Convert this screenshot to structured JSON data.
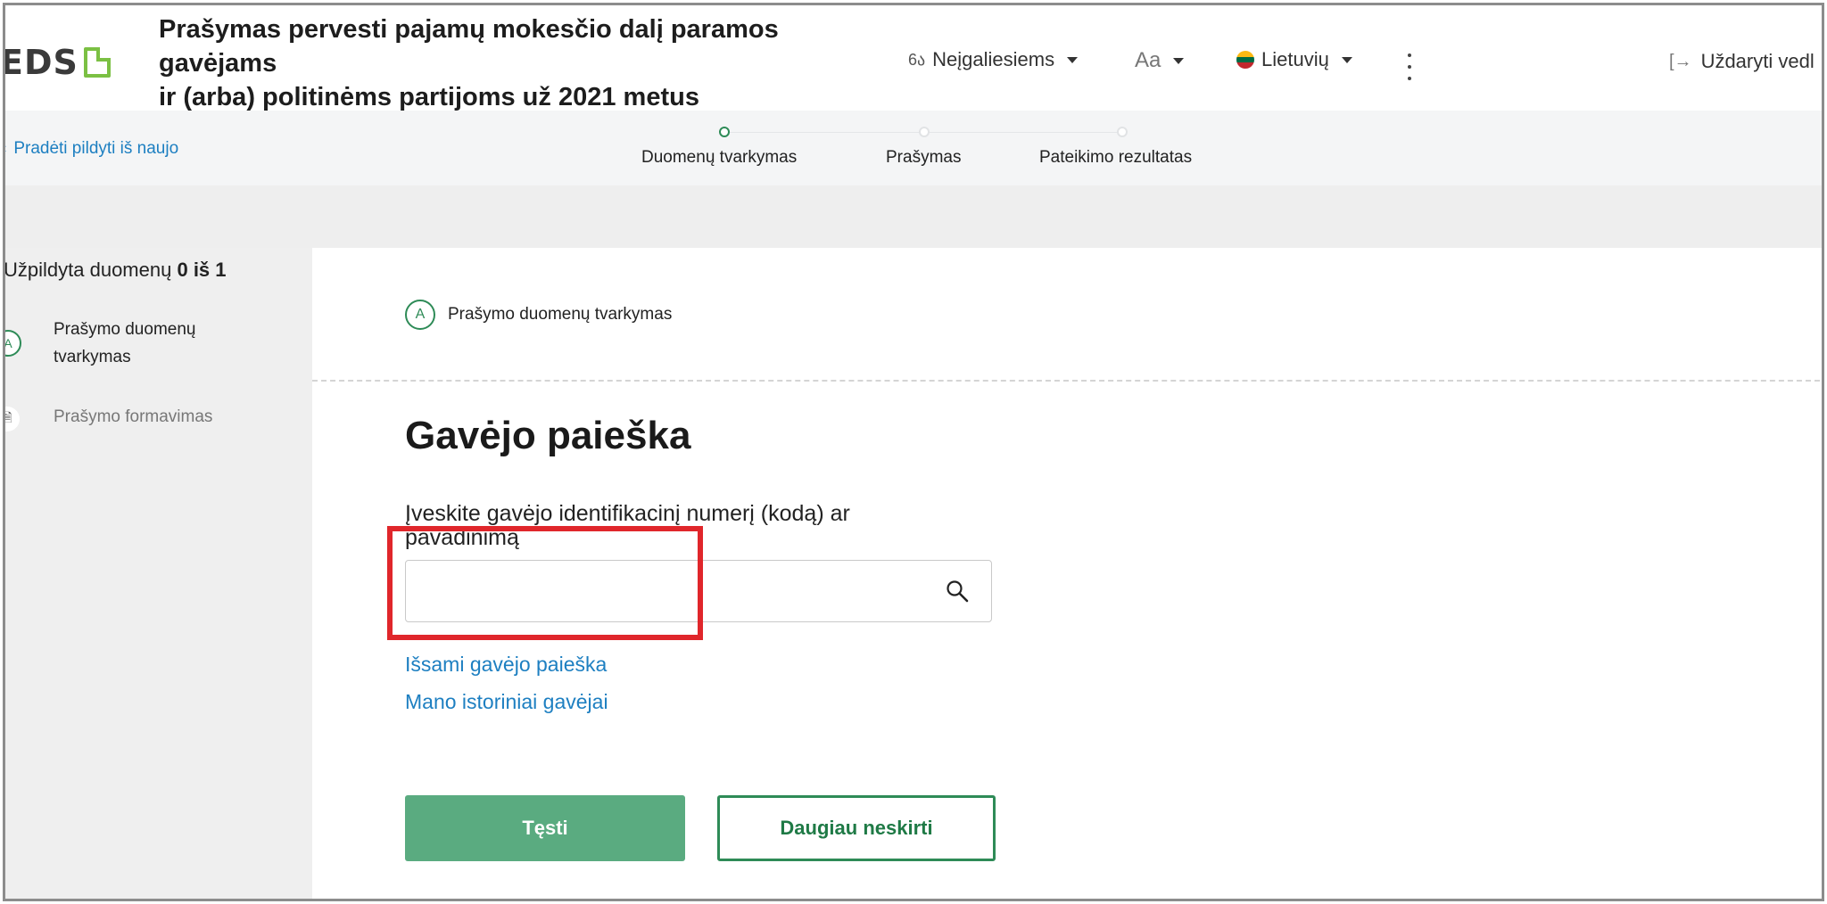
{
  "header": {
    "logo_text": "EDS",
    "title_lines": [
      "Prašymas pervesti pajamų mokesčio dalį paramos",
      "gavėjams",
      "ir (arba) politinėms partijoms už 2021 metus"
    ],
    "accessibility_label": "Neįgaliesiems",
    "font_size_label": "Aa",
    "language_label": "Lietuvių",
    "close_label": "Uždaryti vedl"
  },
  "stepbar": {
    "restart_label": "Pradėti pildyti iš naujo",
    "steps": [
      {
        "label": "Duomenų tvarkymas",
        "active": true
      },
      {
        "label": "Prašymas",
        "active": false
      },
      {
        "label": "Pateikimo rezultatas",
        "active": false
      }
    ]
  },
  "sidebar": {
    "progress_prefix": "Užpildyta duomenų",
    "progress_value": "0 iš 1",
    "items": [
      {
        "badge": "A",
        "label": "Prašymo duomenų tvarkymas"
      },
      {
        "badge": "document-icon",
        "label": "Prašymo formavimas"
      }
    ]
  },
  "main": {
    "section_badge": "A",
    "section_label": "Prašymo duomenų tvarkymas",
    "heading": "Gavėjo paieška",
    "field_label": "Įveskite gavėjo identifikacinį numerį (kodą) ar pavadinimą",
    "search_value": "",
    "links": {
      "detailed_search": "Išsami gavėjo paieška",
      "history": "Mano istoriniai gavėjai"
    },
    "buttons": {
      "continue": "Tęsti",
      "no_more": "Daugiau neskirti"
    }
  },
  "colors": {
    "accent_green": "#5aab80",
    "dark_green": "#2e8b57",
    "link_blue": "#1d7fc1",
    "highlight_red": "#e0262b"
  }
}
